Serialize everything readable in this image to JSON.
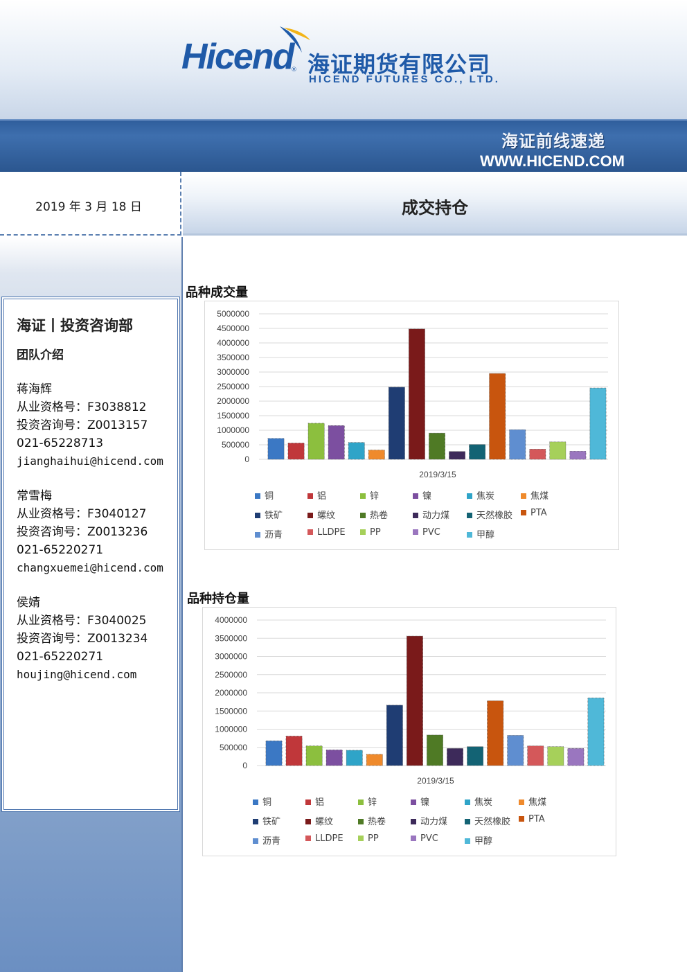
{
  "brand": {
    "logo_latin": "Hicend",
    "logo_reg": "®",
    "logo_cn": "海证期货有限公司",
    "logo_en": "HICEND FUTURES CO., LTD.",
    "banner_title": "海证前线速递",
    "banner_url": "WWW.HICEND.COM"
  },
  "report": {
    "date": "2019 年 3 月 18 日",
    "title": "成交持仓"
  },
  "team": {
    "title": "海证丨投资咨询部",
    "subtitle": "团队介绍",
    "members": [
      {
        "name": "蒋海辉",
        "qualification": "从业资格号：F3038812",
        "consult": "投资咨询号：Z0013157",
        "phone": "021-65228713",
        "email": "jianghaihui@hicend.com"
      },
      {
        "name": "常雪梅",
        "qualification": "从业资格号：F3040127",
        "consult": "投资咨询号：Z0013236",
        "phone": "021-65220271",
        "email": "changxuemei@hicend.com"
      },
      {
        "name": "侯婧",
        "qualification": "从业资格号：F3040025",
        "consult": "投资咨询号：Z0013234",
        "phone": "021-65220271",
        "email": "houjing@hicend.com"
      }
    ]
  },
  "colors": [
    "#3b78c4",
    "#c0373a",
    "#8cbf3e",
    "#7c4fa0",
    "#2fa4c8",
    "#ef8a2c",
    "#1f3d73",
    "#7a1a1a",
    "#4f7a25",
    "#3d2a5a",
    "#136374",
    "#c8550e",
    "#5f8ed0",
    "#d4585a",
    "#a6d05a",
    "#9a76bf",
    "#4fb8d8"
  ],
  "chart_data": [
    {
      "type": "bar",
      "title": "品种成交量",
      "x": "2019/3/15",
      "ylim": [
        0,
        5000000
      ],
      "yticks": [
        "0",
        "500000",
        "1000000",
        "1500000",
        "2000000",
        "2500000",
        "3000000",
        "3500000",
        "4000000",
        "4500000",
        "5000000"
      ],
      "grid": true,
      "legend": "bottom",
      "series": [
        {
          "name": "铜",
          "values": [
            720000
          ]
        },
        {
          "name": "铝",
          "values": [
            560000
          ]
        },
        {
          "name": "锌",
          "values": [
            1240000
          ]
        },
        {
          "name": "镍",
          "values": [
            1160000
          ]
        },
        {
          "name": "焦炭",
          "values": [
            580000
          ]
        },
        {
          "name": "焦煤",
          "values": [
            320000
          ]
        },
        {
          "name": "铁矿",
          "values": [
            2480000
          ]
        },
        {
          "name": "螺纹",
          "values": [
            4480000
          ]
        },
        {
          "name": "热卷",
          "values": [
            900000
          ]
        },
        {
          "name": "动力煤",
          "values": [
            270000
          ]
        },
        {
          "name": "天然橡胶",
          "values": [
            510000
          ]
        },
        {
          "name": "PTA",
          "values": [
            2950000
          ]
        },
        {
          "name": "沥青",
          "values": [
            1020000
          ]
        },
        {
          "name": "LLDPE",
          "values": [
            350000
          ]
        },
        {
          "name": "PP",
          "values": [
            600000
          ]
        },
        {
          "name": "PVC",
          "values": [
            280000
          ]
        },
        {
          "name": "甲醇",
          "values": [
            2450000
          ]
        }
      ]
    },
    {
      "type": "bar",
      "title": "品种持仓量",
      "x": "2019/3/15",
      "ylim": [
        0,
        4000000
      ],
      "yticks": [
        "0",
        "500000",
        "1000000",
        "1500000",
        "2000000",
        "2500000",
        "3000000",
        "3500000",
        "4000000"
      ],
      "grid": true,
      "legend": "bottom",
      "series": [
        {
          "name": "铜",
          "values": [
            680000
          ]
        },
        {
          "name": "铝",
          "values": [
            810000
          ]
        },
        {
          "name": "锌",
          "values": [
            540000
          ]
        },
        {
          "name": "镍",
          "values": [
            430000
          ]
        },
        {
          "name": "焦炭",
          "values": [
            420000
          ]
        },
        {
          "name": "焦煤",
          "values": [
            310000
          ]
        },
        {
          "name": "铁矿",
          "values": [
            1660000
          ]
        },
        {
          "name": "螺纹",
          "values": [
            3560000
          ]
        },
        {
          "name": "热卷",
          "values": [
            840000
          ]
        },
        {
          "name": "动力煤",
          "values": [
            470000
          ]
        },
        {
          "name": "天然橡胶",
          "values": [
            520000
          ]
        },
        {
          "name": "PTA",
          "values": [
            1780000
          ]
        },
        {
          "name": "沥青",
          "values": [
            830000
          ]
        },
        {
          "name": "LLDPE",
          "values": [
            540000
          ]
        },
        {
          "name": "PP",
          "values": [
            520000
          ]
        },
        {
          "name": "PVC",
          "values": [
            470000
          ]
        },
        {
          "name": "甲醇",
          "values": [
            1860000
          ]
        }
      ]
    }
  ]
}
